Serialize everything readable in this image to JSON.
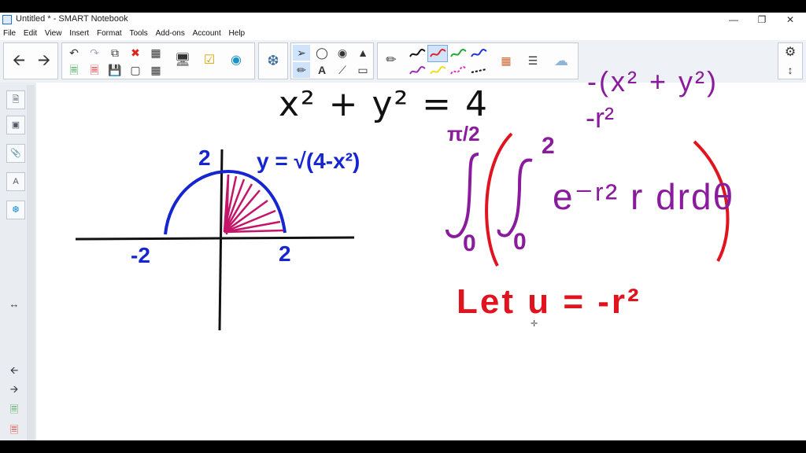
{
  "window": {
    "title": "Untitled * - SMART Notebook",
    "controls": [
      "minimize-icon",
      "restore-icon",
      "close-icon"
    ]
  },
  "menu": [
    "File",
    "Edit",
    "View",
    "Insert",
    "Format",
    "Tools",
    "Add-ons",
    "Account",
    "Help"
  ],
  "toolbar": {
    "nav": [
      "arrow-left-icon",
      "arrow-right-icon"
    ],
    "edit_tools": [
      "undo-icon",
      "redo-icon",
      "paste-icon",
      "delete-icon",
      "table-icon",
      "add-page-icon",
      "remove-page-icon",
      "save-icon",
      "screen-shade-icon",
      "measure-icon",
      "display-icon",
      "lesson-activity-icon",
      "monster-icon",
      "addon-icon"
    ],
    "select_tools": [
      "pointer-icon",
      "shapes-icon",
      "eraser-icon",
      "fill-icon",
      "pen-pair-icon",
      "text-tool-icon",
      "line-tool-icon",
      "eraser2-icon"
    ],
    "pen_colors": [
      "#111111",
      "#e0222e",
      "#23a935",
      "#2234d8",
      "#9b2bb3",
      "#e8e020",
      "#e030c0",
      "#111111"
    ],
    "selected_pen": 1
  },
  "board": {
    "equation_top": "x² + y² = 4",
    "partial_top_right": "-(x² + y²)",
    "minus_r2": "-r²",
    "axis_label_2_top": "2",
    "axis_label_neg2": "-2",
    "axis_label_2_right": "2",
    "curve_label": "y = √(4-x²)",
    "integral_upper_outer": "π/2",
    "integral_upper_inner": "2",
    "integral_lower_outer": "0",
    "integral_lower_inner": "0",
    "integrand": "e⁻ʳ² r drdθ",
    "substitution": "Let u = -r²"
  },
  "colors": {
    "blue_ink": "#1525d0",
    "purple_ink": "#8a1b9c",
    "red_ink": "#e0141f",
    "black_ink": "#111111",
    "magenta_ink": "#c41569"
  }
}
